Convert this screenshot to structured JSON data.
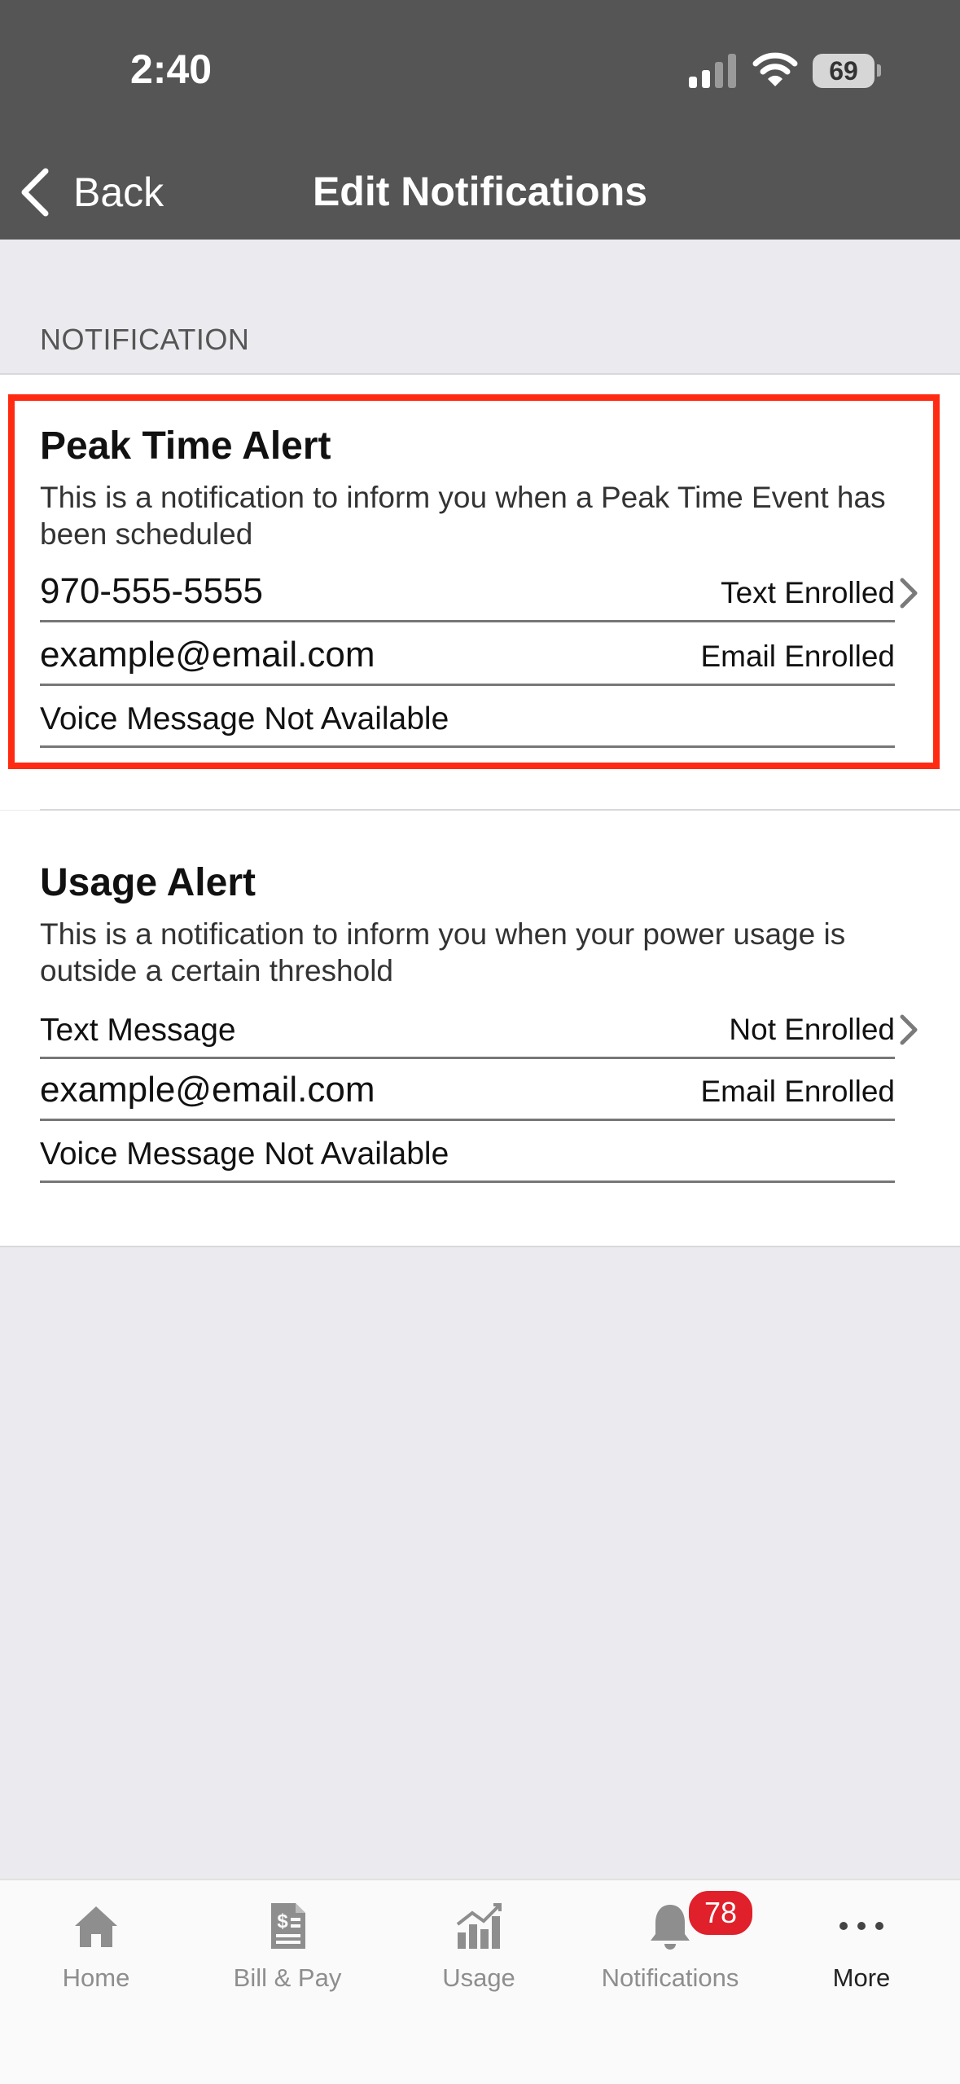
{
  "status_bar": {
    "time": "2:40",
    "battery": "69"
  },
  "nav": {
    "back_label": "Back",
    "title": "Edit Notifications"
  },
  "section_header": "NOTIFICATION",
  "alerts": [
    {
      "title": "Peak Time Alert",
      "description": "This is a notification to inform you when a Peak Time Event has been scheduled",
      "rows": [
        {
          "left": "970-555-5555",
          "right": "Text Enrolled"
        },
        {
          "left": "example@email.com",
          "right": "Email Enrolled"
        },
        {
          "left": "Voice Message Not Available",
          "right": ""
        }
      ]
    },
    {
      "title": "Usage Alert",
      "description": "This is a notification to inform you when your power usage is outside a certain threshold",
      "rows": [
        {
          "left": "Text Message",
          "right": "Not Enrolled"
        },
        {
          "left": "example@email.com",
          "right": "Email Enrolled"
        },
        {
          "left": "Voice Message Not Available",
          "right": ""
        }
      ]
    }
  ],
  "highlight_color": "#ff2a12",
  "tabs": [
    {
      "label": "Home",
      "icon": "home-icon"
    },
    {
      "label": "Bill & Pay",
      "icon": "bill-icon"
    },
    {
      "label": "Usage",
      "icon": "usage-chart-icon"
    },
    {
      "label": "Notifications",
      "icon": "bell-icon"
    },
    {
      "label": "More",
      "icon": "more-dots-icon"
    }
  ],
  "notification_badge": "78"
}
